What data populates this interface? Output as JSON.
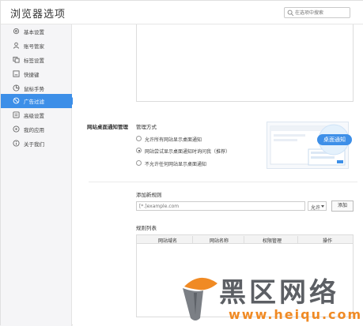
{
  "window": {
    "title": "浏览器选项",
    "search_placeholder": "在选项中搜索"
  },
  "sidebar": {
    "items": [
      {
        "label": "基本设置",
        "icon": "gear-icon"
      },
      {
        "label": "账号管家",
        "icon": "user-icon"
      },
      {
        "label": "标签设置",
        "icon": "tabs-icon"
      },
      {
        "label": "快捷键",
        "icon": "keyboard-icon"
      },
      {
        "label": "鼠标手势",
        "icon": "mouse-icon"
      },
      {
        "label": "广告过滤",
        "icon": "block-icon"
      },
      {
        "label": "高级设置",
        "icon": "advanced-icon"
      },
      {
        "label": "我的应用",
        "icon": "apps-icon"
      },
      {
        "label": "关于我们",
        "icon": "info-icon"
      }
    ],
    "active_index": 5
  },
  "notifications": {
    "section_label": "网站桌面通知管理",
    "manage_label": "管理方式",
    "options": [
      {
        "label": "允许所有网站显示桌面通知",
        "checked": false
      },
      {
        "label": "网站尝试显示桌面通知时询问我（推荐）",
        "checked": true
      },
      {
        "label": "不允许任何网站显示桌面通知",
        "checked": false
      }
    ],
    "preview_text": "桌面通知"
  },
  "rules": {
    "add_label": "添加新规则",
    "input_placeholder": "[*.]example.com",
    "select_value": "允许",
    "add_button": "添加",
    "list_label": "规则列表",
    "columns": [
      "网站域名",
      "网站名称",
      "权限管理",
      "操作"
    ]
  },
  "watermark": {
    "brand": "黑区网络",
    "url": "www.heiqu.com"
  },
  "colors": {
    "accent": "#3d8fe8",
    "sidebar_bg": "#f5f5f7"
  }
}
